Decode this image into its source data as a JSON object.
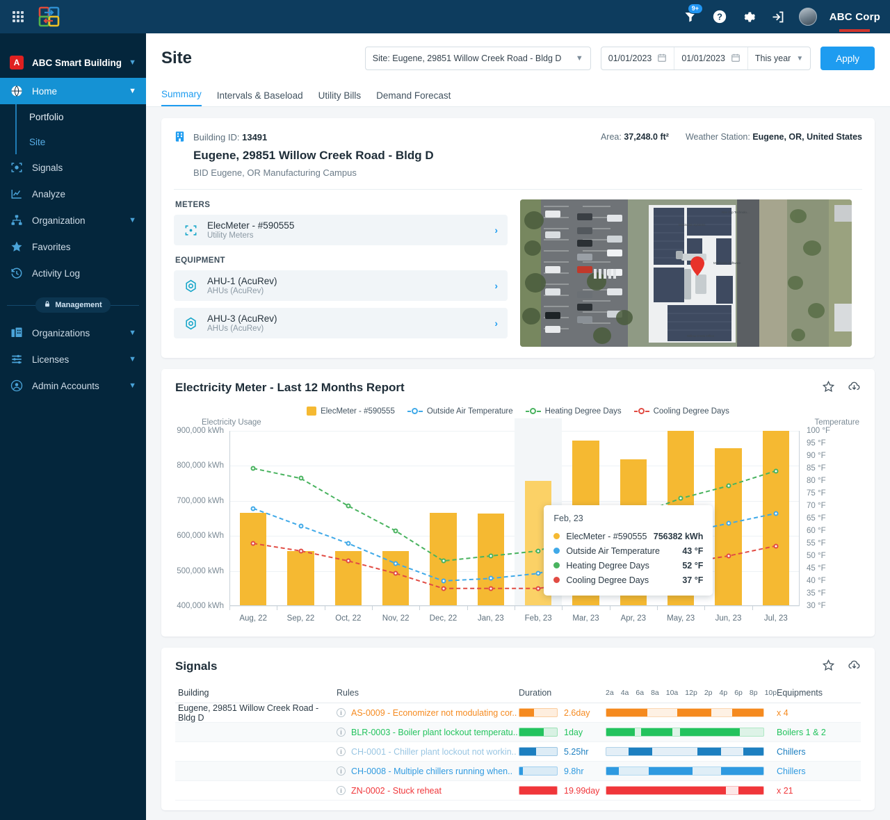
{
  "topbar": {
    "apps_icon": "grid-apps-icon",
    "logo_icon": "brand-logo-icon",
    "notifications": {
      "icon": "notification-icon",
      "badge": "9+"
    },
    "help_icon": "help-icon",
    "settings_icon": "gear-icon",
    "logout_icon": "logout-icon",
    "avatar_icon": "user-avatar",
    "corp_name": "ABC Corp"
  },
  "sidebar": {
    "org": {
      "initial": "A",
      "name": "ABC Smart Building"
    },
    "items": [
      {
        "label": "Home",
        "icon": "globe-icon",
        "active": true,
        "expandable": true
      },
      {
        "label": "Signals",
        "icon": "signal-scan-icon",
        "active": false,
        "expandable": false
      },
      {
        "label": "Analyze",
        "icon": "analyze-chart-icon",
        "active": false,
        "expandable": false
      },
      {
        "label": "Organization",
        "icon": "org-tree-icon",
        "active": false,
        "expandable": true
      },
      {
        "label": "Favorites",
        "icon": "star-icon",
        "active": false,
        "expandable": false
      },
      {
        "label": "Activity Log",
        "icon": "history-icon",
        "active": false,
        "expandable": false
      }
    ],
    "subitems": [
      {
        "label": "Portfolio",
        "active": false
      },
      {
        "label": "Site",
        "active": true
      }
    ],
    "management_label": "Management",
    "management_icon": "lock-icon",
    "management_items": [
      {
        "label": "Organizations",
        "icon": "buildings-icon",
        "expandable": true
      },
      {
        "label": "Licenses",
        "icon": "license-icon",
        "expandable": true
      },
      {
        "label": "Admin Accounts",
        "icon": "account-circle-icon",
        "expandable": true
      }
    ]
  },
  "header": {
    "title": "Site",
    "site_selector": {
      "value": "Site: Eugene, 29851 Willow Creek Road - Bldg D",
      "icon": "chevron-down-icon"
    },
    "date_from": "01/01/2023",
    "date_to": "01/01/2023",
    "calendar_icon": "calendar-icon",
    "range_preset": "This year",
    "apply_label": "Apply"
  },
  "tabs": [
    {
      "label": "Summary",
      "active": true
    },
    {
      "label": "Intervals & Baseload",
      "active": false
    },
    {
      "label": "Utility Bills",
      "active": false
    },
    {
      "label": "Demand Forecast",
      "active": false
    }
  ],
  "building": {
    "icon": "building-icon",
    "id_label": "Building ID:",
    "id_value": "13491",
    "area_label": "Area:",
    "area_value": "37,248.0 ft²",
    "weather_label": "Weather Station:",
    "weather_value": "Eugene, OR, United States",
    "name": "Eugene, 29851 Willow Creek Road - Bldg D",
    "campus": "BID Eugene, OR Manufacturing Campus",
    "meters_label": "METERS",
    "meters": [
      {
        "name": "ElecMeter - #590555",
        "type": "Utility Meters",
        "icon": "meter-icon"
      }
    ],
    "equipment_label": "EQUIPMENT",
    "equipment": [
      {
        "name": "AHU-1 (AcuRev)",
        "type": "AHUs (AcuRev)",
        "icon": "equipment-icon"
      },
      {
        "name": "AHU-3 (AcuRev)",
        "type": "AHUs (AcuRev)",
        "icon": "equipment-icon"
      }
    ],
    "map_alt": "aerial-satellite-view-of-building"
  },
  "chart_card": {
    "title": "Electricity Meter - Last 12 Months Report",
    "favorite_icon": "star-outline-icon",
    "download_icon": "cloud-download-icon"
  },
  "chart_data": {
    "type": "bar",
    "title": "Electricity Meter - Last 12 Months Report",
    "xlabel": "",
    "ylabel": "Electricity Usage",
    "y2label": "Temperature",
    "ylim": [
      400000,
      900000
    ],
    "y2lim": [
      30,
      100
    ],
    "yticks": [
      "400,000 kWh",
      "500,000 kWh",
      "600,000 kWh",
      "700,000 kWh",
      "800,000 kWh",
      "900,000 kWh"
    ],
    "y2ticks": [
      "30 °F",
      "35 °F",
      "40 °F",
      "45 °F",
      "50 °F",
      "55 °F",
      "60 °F",
      "65 °F",
      "70 °F",
      "75 °F",
      "80 °F",
      "85 °F",
      "90 °F",
      "95 °F",
      "100 °F"
    ],
    "grid": true,
    "legend_position": "top-center",
    "categories": [
      "Aug, 22",
      "Sep, 22",
      "Oct, 22",
      "Nov, 22",
      "Dec, 22",
      "Jan, 23",
      "Feb, 23",
      "Mar, 23",
      "Apr, 23",
      "May, 23",
      "Jun, 23",
      "Jul, 23"
    ],
    "highlighted_category": "Feb, 23",
    "series": [
      {
        "name": "ElecMeter - #590555",
        "type": "bar",
        "unit": "kWh",
        "color": "#f5b932",
        "axis": "left",
        "values": [
          665000,
          556000,
          556000,
          556000,
          666000,
          664000,
          756382,
          872000,
          818000,
          900000,
          850000,
          900000
        ]
      },
      {
        "name": "Outside Air Temperature",
        "type": "line",
        "unit": "°F",
        "color": "#3fa9e8",
        "axis": "right",
        "values": [
          69,
          62,
          55,
          47,
          40,
          41,
          43,
          48,
          53,
          59,
          63,
          67
        ]
      },
      {
        "name": "Heating Degree Days",
        "type": "line",
        "unit": "°F",
        "color": "#49b35f",
        "axis": "right",
        "values": [
          85,
          81,
          70,
          60,
          48,
          50,
          52,
          59,
          66,
          73,
          78,
          84
        ]
      },
      {
        "name": "Cooling Degree Days",
        "type": "line",
        "unit": "°F",
        "color": "#e14b43",
        "axis": "right",
        "values": [
          55,
          52,
          48,
          43,
          37,
          37,
          37,
          40,
          43,
          47,
          50,
          54
        ]
      }
    ],
    "tooltip": {
      "title": "Feb, 23",
      "rows": [
        {
          "label": "ElecMeter - #590555",
          "value": "756382 kWh",
          "color": "#f5b932"
        },
        {
          "label": "Outside Air Temperature",
          "value": "43 °F",
          "color": "#3fa9e8"
        },
        {
          "label": "Heating Degree Days",
          "value": "52 °F",
          "color": "#49b35f"
        },
        {
          "label": "Cooling Degree Days",
          "value": "37 °F",
          "color": "#e14b43"
        }
      ]
    }
  },
  "signals_card": {
    "title": "Signals",
    "favorite_icon": "star-outline-icon",
    "download_icon": "cloud-download-icon",
    "columns": [
      "Building",
      "Rules",
      "Duration",
      "Equipments"
    ],
    "time_ticks": [
      "2a",
      "4a",
      "6a",
      "8a",
      "10a",
      "12p",
      "2p",
      "4p",
      "6p",
      "8p",
      "10p"
    ],
    "rows": [
      {
        "building": "Eugene, 29851 Willow Creek Road - Bldg D",
        "rule": "AS-0009 - Economizer not modulating cor..",
        "duration": "2.6day",
        "equipment": "x 4",
        "color": "#f58a1f",
        "mini_fill": 38,
        "timeline": [
          [
            0,
            26
          ],
          [
            45,
            22
          ],
          [
            80,
            20
          ]
        ]
      },
      {
        "building": "",
        "rule": "BLR-0003 - Boiler plant lockout temperatu..",
        "duration": "1day",
        "equipment": "Boilers 1 & 2",
        "color": "#23c35e",
        "mini_fill": 64,
        "timeline": [
          [
            0,
            18
          ],
          [
            22,
            20
          ],
          [
            47,
            38
          ]
        ]
      },
      {
        "building": "",
        "rule": "CH-0001 - Chiller plant lockout not workin..",
        "duration": "5.25hr",
        "equipment": "Chillers",
        "color": "#1d7fc0",
        "mini_fill": 44,
        "timeline": [
          [
            14,
            15
          ],
          [
            58,
            15
          ],
          [
            87,
            13
          ]
        ]
      },
      {
        "building": "",
        "rule": "CH-0008 - Multiple chillers running when..",
        "duration": "9.8hr",
        "equipment": "Chillers",
        "color": "#2f9ae0",
        "mini_fill": 10,
        "timeline": [
          [
            0,
            8
          ],
          [
            27,
            28
          ],
          [
            73,
            27
          ]
        ]
      },
      {
        "building": "",
        "rule": "ZN-0002 - Stuck reheat",
        "duration": "19.99day",
        "equipment": "x 21",
        "color": "#f0363a",
        "mini_fill": 100,
        "timeline": [
          [
            0,
            76
          ],
          [
            84,
            16
          ]
        ]
      }
    ]
  },
  "colors": {
    "accent": "#1e9cf0",
    "sidebar_bg": "#04263c",
    "topbar_bg": "#0d3c5e",
    "active_nav": "#1592d4",
    "bar": "#f5b932"
  }
}
